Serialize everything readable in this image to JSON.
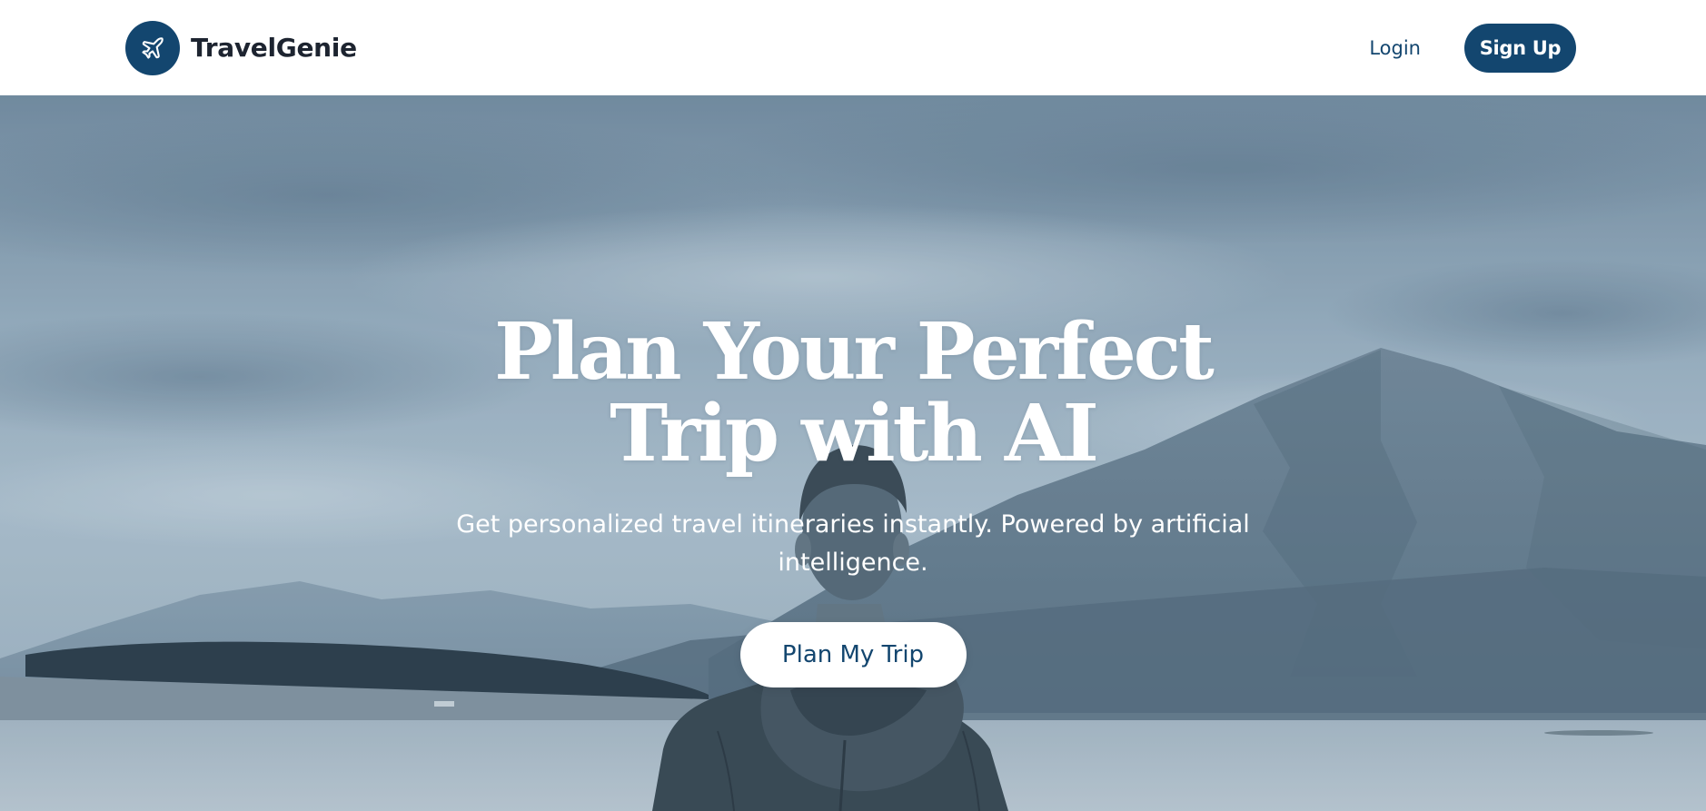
{
  "header": {
    "brand_name": "TravelGenie",
    "logo_icon": "airplane-icon",
    "login_label": "Login",
    "signup_label": "Sign Up"
  },
  "hero": {
    "title": "Plan Your Perfect Trip with AI",
    "subtitle": "Get personalized travel itineraries instantly. Powered by artificial intelligence.",
    "cta_label": "Plan My Trip",
    "background_image": "traveler-facing-mountains-lake-photo"
  },
  "colors": {
    "brand_primary": "#13466f",
    "header_background": "#ffffff",
    "hero_text": "#ffffff",
    "cta_background": "#ffffff",
    "brand_text": "#1d2430"
  }
}
